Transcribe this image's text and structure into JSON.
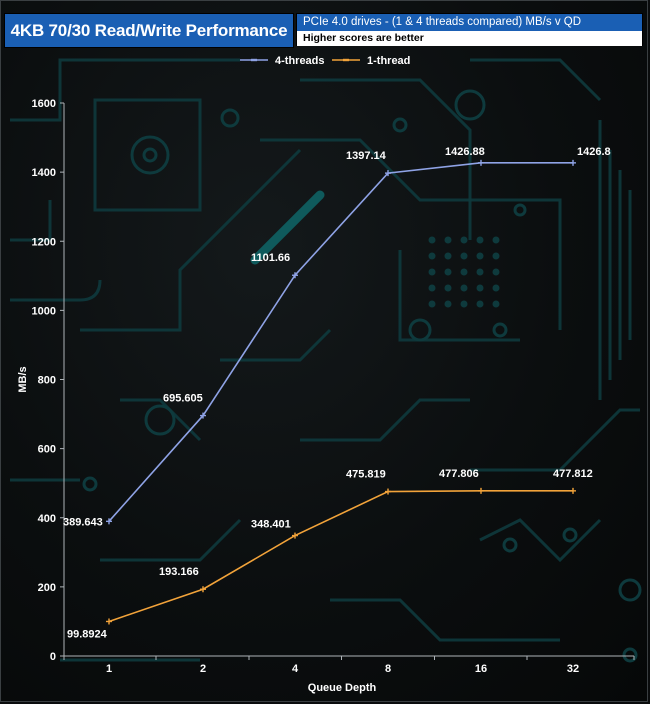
{
  "header": {
    "title": "4KB 70/30 Read/Write Performance",
    "subtitle": "PCIe 4.0 drives - (1 & 4 threads compared) MB/s v QD",
    "note": "Higher scores are better"
  },
  "colors": {
    "header_bg": "#1a5fb4",
    "series_4_threads": "#8fa3e6",
    "series_1_thread": "#f2a33a",
    "circuit": "#0e3a3d"
  },
  "chart_data": {
    "type": "line",
    "title": "4KB 70/30 Read/Write Performance",
    "subtitle": "PCIe 4.0 drives - (1 & 4 threads compared) MB/s v QD",
    "xlabel": "Queue Depth",
    "ylabel": "MB/s",
    "categories": [
      "1",
      "2",
      "4",
      "8",
      "16",
      "32"
    ],
    "ylim": [
      0,
      1600
    ],
    "yticks": [
      0,
      200,
      400,
      600,
      800,
      1000,
      1200,
      1400,
      1600
    ],
    "legend_position": "top-center",
    "grid": false,
    "series": [
      {
        "name": "4-threads",
        "values": [
          389.643,
          695.605,
          1101.66,
          1397.14,
          1426.88,
          1426.8
        ],
        "labels": [
          "389.643",
          "695.605",
          "1101.66",
          "1397.14",
          "1426.88",
          "1426.8"
        ]
      },
      {
        "name": "1-thread",
        "values": [
          99.8924,
          193.166,
          348.401,
          475.819,
          477.806,
          477.812
        ],
        "labels": [
          "99.8924",
          "193.166",
          "348.401",
          "475.819",
          "477.806",
          "477.812"
        ]
      }
    ]
  }
}
